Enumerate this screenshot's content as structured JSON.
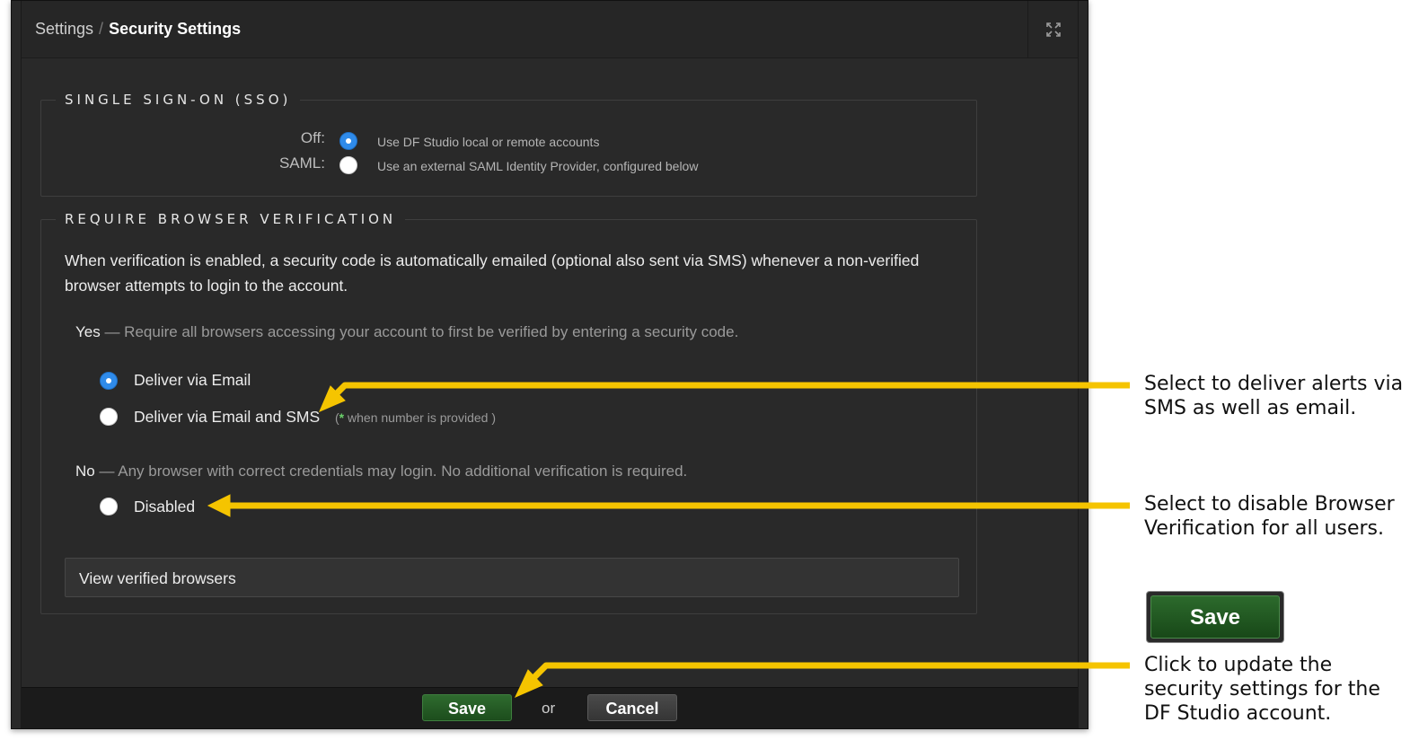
{
  "header": {
    "breadcrumb_parent": "Settings",
    "breadcrumb_separator": "/",
    "breadcrumb_current": "Security Settings"
  },
  "sso": {
    "legend": "SINGLE SIGN-ON (SSO)",
    "options": [
      {
        "label": "Off:",
        "description": "Use DF Studio local or remote accounts",
        "selected": true
      },
      {
        "label": "SAML:",
        "description": "Use an external SAML Identity Provider, configured below",
        "selected": false
      }
    ]
  },
  "verification": {
    "legend": "REQUIRE BROWSER VERIFICATION",
    "intro": "When verification is enabled, a security code is automatically emailed (optional also sent via SMS) whenever a non-verified browser attempts to login to the account.",
    "yes_label": "Yes",
    "yes_desc": " — Require all browsers accessing your account to first be verified by entering a security code.",
    "option_email": "Deliver via Email",
    "option_email_sms": "Deliver via Email and SMS",
    "sms_note_open": "(",
    "sms_note_star": "*",
    "sms_note_text": " when number is provided )",
    "no_label": "No",
    "no_desc": " — Any browser with correct credentials may login. No additional verification is required.",
    "option_disabled": "Disabled",
    "selected": "email",
    "view_button": "View verified browsers"
  },
  "footer": {
    "save": "Save",
    "or": "or",
    "cancel": "Cancel"
  },
  "annotations": {
    "sms_callout": "Select to deliver alerts via SMS as well as email.",
    "disable_callout": "Select to disable Browser Verification for all users.",
    "save_callout": "Click to update the security settings for the DF Studio account.",
    "save_sample": "Save",
    "arrow_color": "#f5c400"
  },
  "colors": {
    "radio_selected": "#2f8bea",
    "save_green": "#1c4d1c",
    "panel_bg": "#292929"
  }
}
